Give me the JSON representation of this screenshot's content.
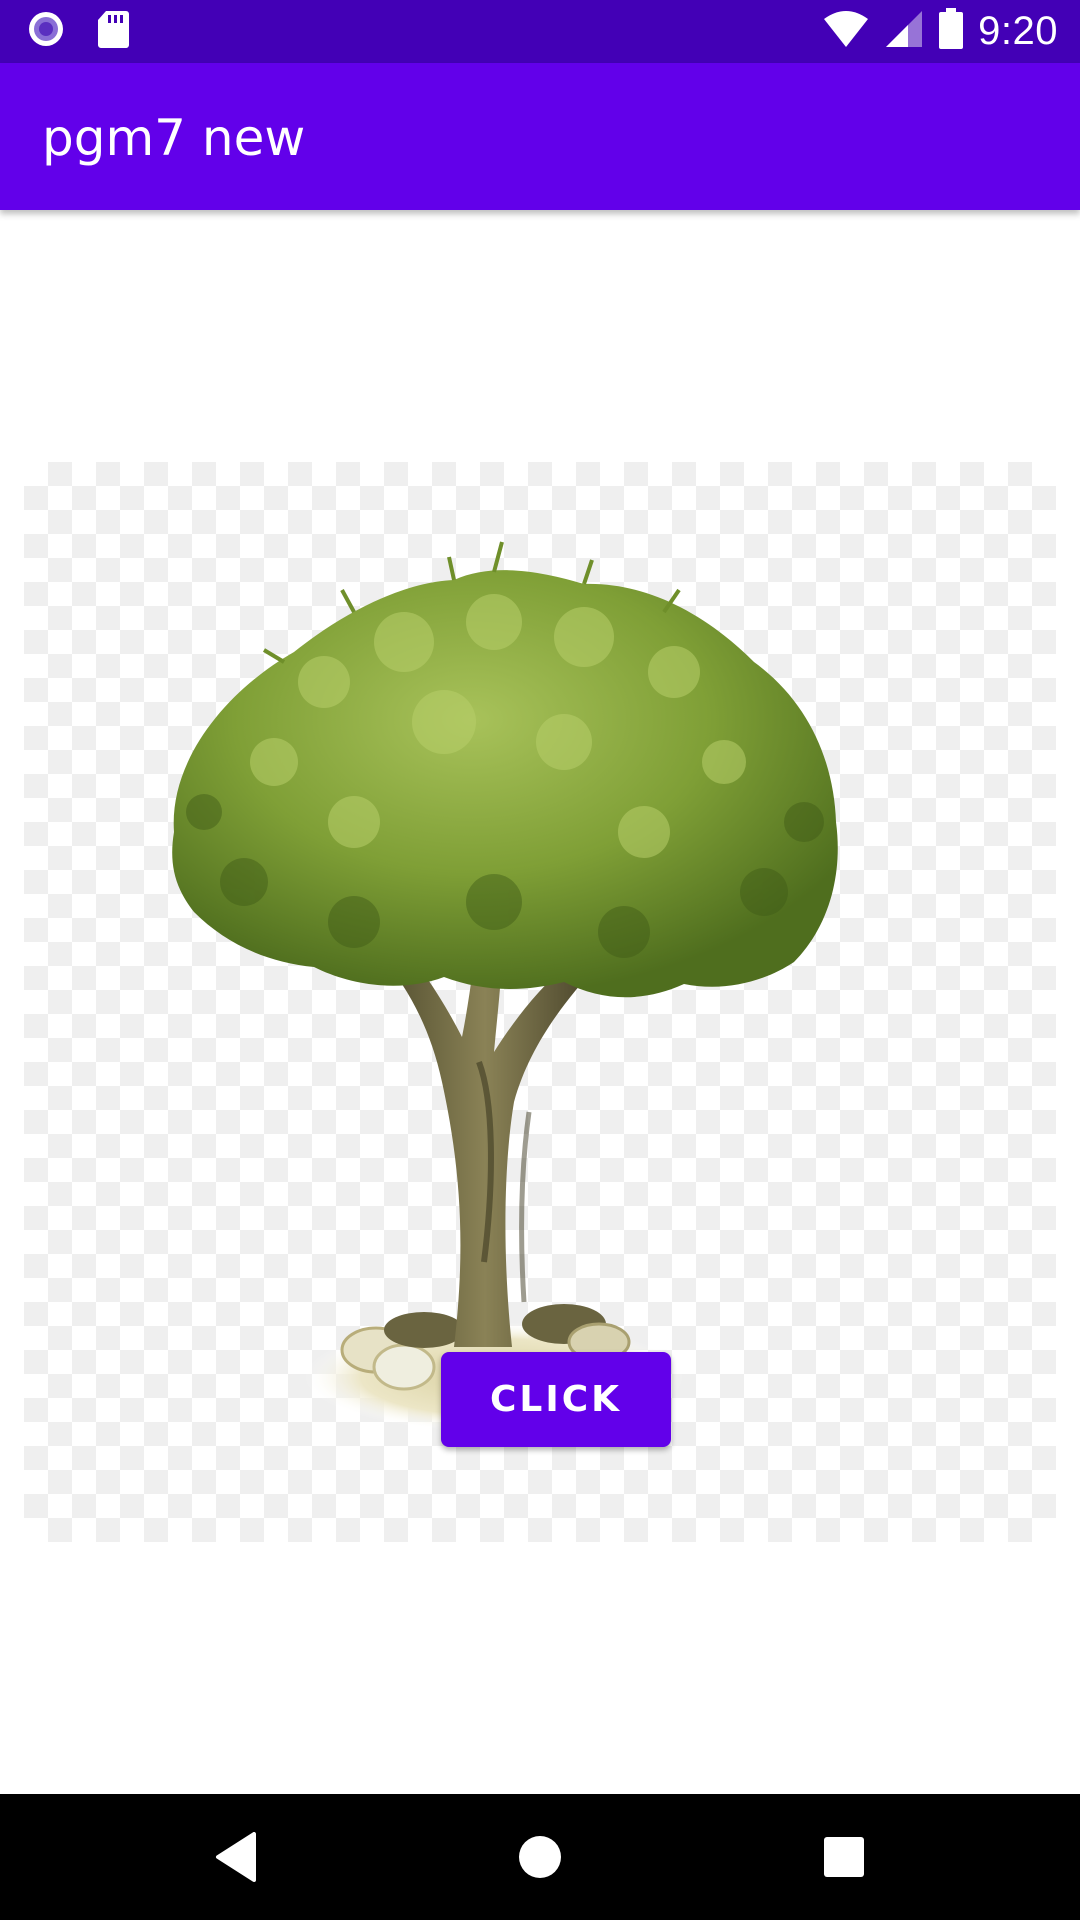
{
  "status_bar": {
    "time": "9:20",
    "background": "#4300b6",
    "icons_left": [
      "circle-notification-icon",
      "sd-card-icon"
    ],
    "icons_right": [
      "wifi-icon",
      "signal-icon",
      "battery-icon"
    ]
  },
  "app_bar": {
    "title": "pgm7 new",
    "background": "#6200ea"
  },
  "image": {
    "subject": "tree-image"
  },
  "button": {
    "label": "CLICK",
    "background": "#6200ea"
  },
  "nav_bar": {
    "icons": [
      "back-icon",
      "home-icon",
      "recents-icon"
    ]
  }
}
